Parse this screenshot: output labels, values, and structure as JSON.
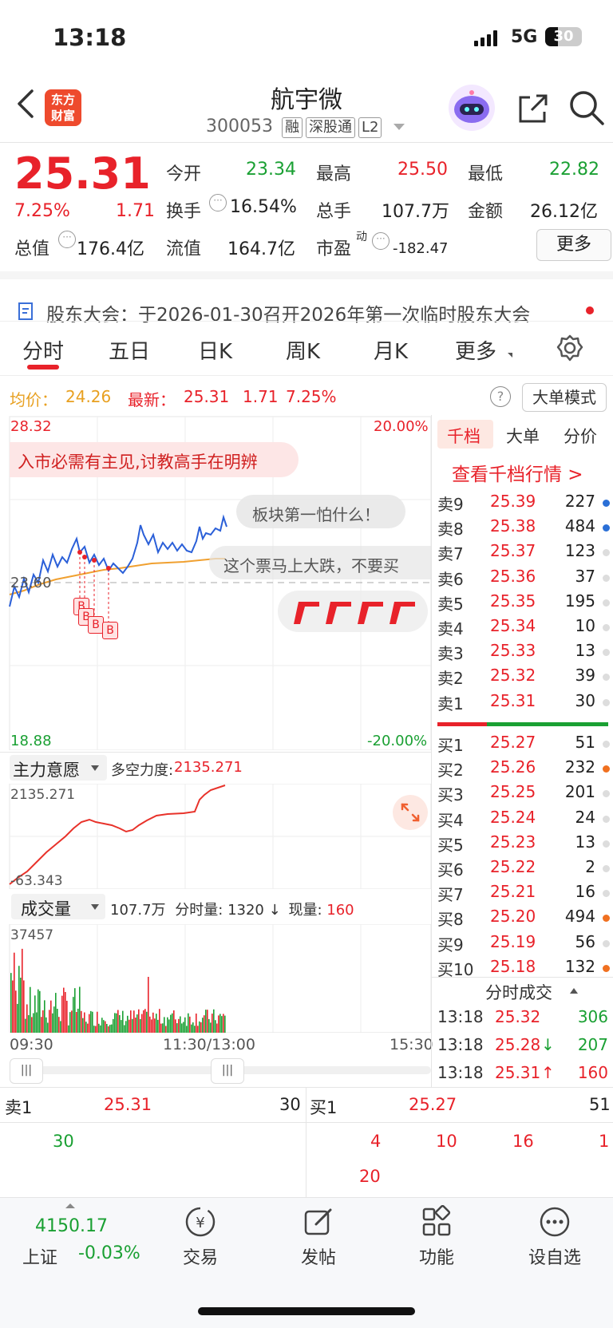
{
  "status_bar": {
    "time": "13:18",
    "network": "5G",
    "battery": "30"
  },
  "header": {
    "logo_text": [
      "东方",
      "财富"
    ],
    "title": "航宇微",
    "code": "300053",
    "tags": [
      "融",
      "深股通",
      "L2"
    ]
  },
  "quote": {
    "price": "25.31",
    "change_pct": "7.25%",
    "change": "1.71",
    "open_label": "今开",
    "open": "23.34",
    "high_label": "最高",
    "high": "25.50",
    "low_label": "最低",
    "low": "22.82",
    "turnover_label": "换手",
    "turnover": "16.54%",
    "volume_label": "总手",
    "volume": "107.7万",
    "amount_label": "金额",
    "amount": "26.12亿",
    "mcap_label": "总值",
    "mcap": "176.4亿",
    "float_label": "流值",
    "float": "164.7亿",
    "pe_label": "市盈",
    "pe_sup": "动",
    "pe": "-182.47",
    "more_button": "更多"
  },
  "notice": {
    "text": "股东大会：于2026-01-30召开2026年第一次临时股东大会"
  },
  "chart_tabs": [
    "分时",
    "五日",
    "日K",
    "周K",
    "月K",
    "更多"
  ],
  "chart_info": {
    "avg_label": "均价：",
    "avg": "24.26",
    "latest_label": "最新：",
    "latest": "25.31",
    "latest_change": "1.71",
    "latest_pct": "7.25%",
    "big_order_mode": "大单模式"
  },
  "intraday": {
    "y_top": "28.32",
    "y_bottom": "18.88",
    "pct_top": "20.00%",
    "pct_bottom": "-20.00%",
    "ref_price": "23.60",
    "marquee": "入市必需有主见,讨教高手在明辨",
    "bubbles": [
      "板块第一怕什么！",
      "这个票马上大跌，不要买"
    ],
    "buy_marks": [
      "B",
      "B",
      "B",
      "B"
    ]
  },
  "main_force": {
    "label": "主力意愿",
    "power_label": "多空力度:",
    "power": "2135.271",
    "top": "2135.271",
    "bottom": "-63.343"
  },
  "volume_panel": {
    "label": "成交量",
    "total": "107.7万",
    "interval_label": "分时量:",
    "interval": "1320",
    "arrow": "↓",
    "now_label": "现量:",
    "now": "160",
    "top": "37457"
  },
  "time_axis": {
    "start": "09:30",
    "mid": "11:30/13:00",
    "end": "15:30"
  },
  "order_book": {
    "tabs": [
      "千档",
      "大单",
      "分价"
    ],
    "link": "查看千档行情 >",
    "asks": [
      {
        "label": "卖9",
        "price": "25.39",
        "qty": "227",
        "dot": "#2a6fd6"
      },
      {
        "label": "卖8",
        "price": "25.38",
        "qty": "484",
        "dot": "#2a6fd6"
      },
      {
        "label": "卖7",
        "price": "25.37",
        "qty": "123",
        "dot": "#dddddd"
      },
      {
        "label": "卖6",
        "price": "25.36",
        "qty": "37",
        "dot": "#dddddd"
      },
      {
        "label": "卖5",
        "price": "25.35",
        "qty": "195",
        "dot": "#dddddd"
      },
      {
        "label": "卖4",
        "price": "25.34",
        "qty": "10",
        "dot": "#dddddd"
      },
      {
        "label": "卖3",
        "price": "25.33",
        "qty": "13",
        "dot": "#dddddd"
      },
      {
        "label": "卖2",
        "price": "25.32",
        "qty": "39",
        "dot": "#dddddd"
      },
      {
        "label": "卖1",
        "price": "25.31",
        "qty": "30",
        "dot": "#dddddd"
      }
    ],
    "bids": [
      {
        "label": "买1",
        "price": "25.27",
        "qty": "51",
        "dot": "#dddddd"
      },
      {
        "label": "买2",
        "price": "25.26",
        "qty": "232",
        "dot": "#f07020"
      },
      {
        "label": "买3",
        "price": "25.25",
        "qty": "201",
        "dot": "#dddddd"
      },
      {
        "label": "买4",
        "price": "25.24",
        "qty": "24",
        "dot": "#dddddd"
      },
      {
        "label": "买5",
        "price": "25.23",
        "qty": "13",
        "dot": "#dddddd"
      },
      {
        "label": "买6",
        "price": "25.22",
        "qty": "2",
        "dot": "#dddddd"
      },
      {
        "label": "买7",
        "price": "25.21",
        "qty": "16",
        "dot": "#dddddd"
      },
      {
        "label": "买8",
        "price": "25.20",
        "qty": "494",
        "dot": "#f07020"
      },
      {
        "label": "买9",
        "price": "25.19",
        "qty": "56",
        "dot": "#dddddd"
      },
      {
        "label": "买10",
        "price": "25.18",
        "qty": "132",
        "dot": "#f07020"
      }
    ],
    "trades_title": "分时成交",
    "trades": [
      {
        "time": "13:18",
        "price": "25.32",
        "arrow": "",
        "qty": "306",
        "color": "#1aa033"
      },
      {
        "time": "13:18",
        "price": "25.28",
        "arrow": "↓",
        "qty": "207",
        "color": "#1aa033"
      },
      {
        "time": "13:18",
        "price": "25.31",
        "arrow": "↑",
        "qty": "160",
        "color": "#e8222a"
      }
    ]
  },
  "level_bar": {
    "ask_label": "卖1",
    "ask_price": "25.31",
    "ask_qty": "30",
    "bid_label": "买1",
    "bid_price": "25.27",
    "bid_qty": "51",
    "ask_queue": [
      "30"
    ],
    "bid_queue": [
      "4",
      "10",
      "16",
      "1",
      "20"
    ]
  },
  "bottom_nav": {
    "index_value": "4150.17",
    "index_name": "上证",
    "index_change": "-0.03%",
    "items": [
      "交易",
      "发帖",
      "功能",
      "设自选"
    ]
  }
}
